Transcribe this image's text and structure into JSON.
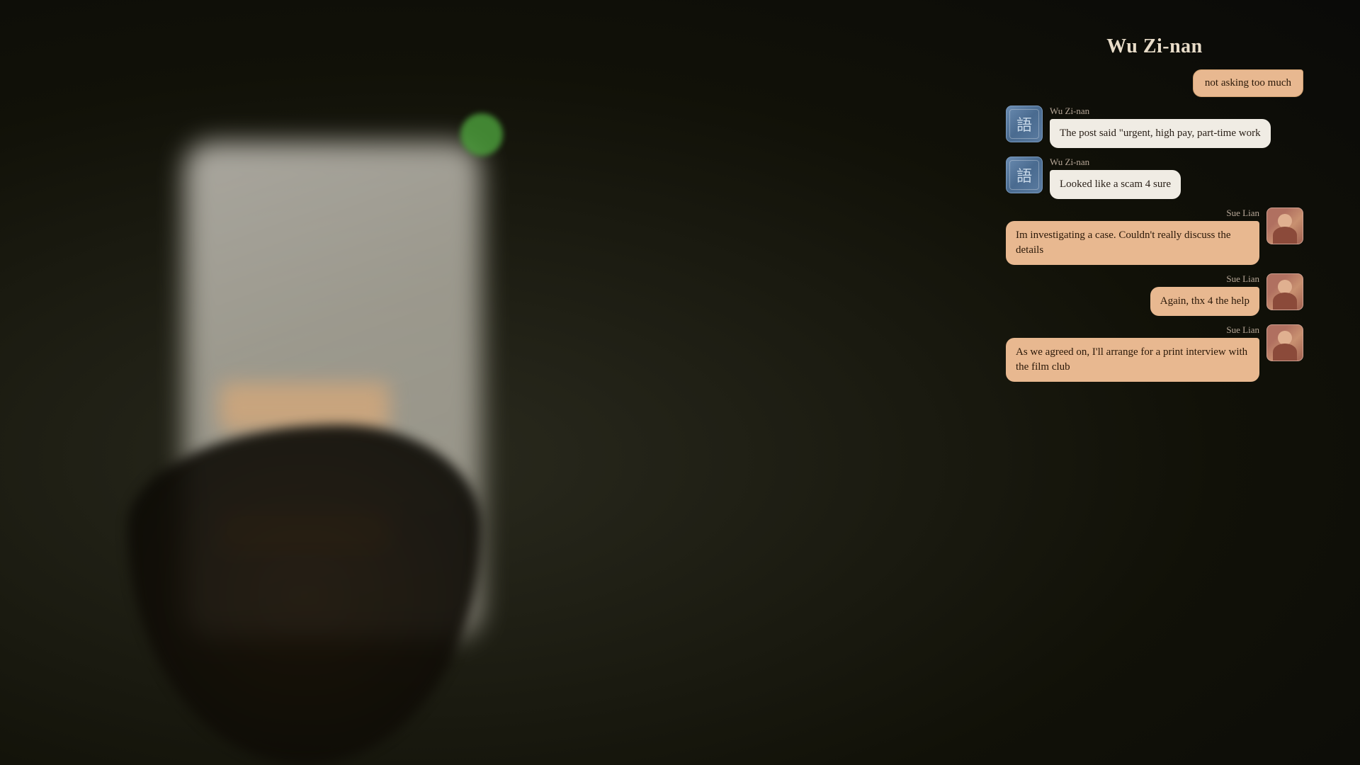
{
  "background": {
    "color": "#1a1a14"
  },
  "chat": {
    "header": "Wu Zi-nan",
    "messages": [
      {
        "id": "msg-0",
        "sender": "Sue Lian",
        "type": "sent",
        "text": "not asking too much",
        "avatar_type": "sue"
      },
      {
        "id": "msg-1",
        "sender": "Wu Zi-nan",
        "type": "received",
        "text": "The post said \"urgent, high pay, part-time work",
        "avatar_type": "wu"
      },
      {
        "id": "msg-2",
        "sender": "Wu Zi-nan",
        "type": "received",
        "text": "Looked like a scam 4 sure",
        "avatar_type": "wu"
      },
      {
        "id": "msg-3",
        "sender": "Sue Lian",
        "type": "sent",
        "text": "Im investigating a case. Couldn't really discuss the details",
        "avatar_type": "sue"
      },
      {
        "id": "msg-4",
        "sender": "Sue Lian",
        "type": "sent",
        "text": "Again, thx 4 the help",
        "avatar_type": "sue"
      },
      {
        "id": "msg-5",
        "sender": "Sue Lian",
        "type": "sent",
        "text": "As we agreed on, I'll arrange for a print interview with the film club",
        "avatar_type": "sue"
      }
    ]
  }
}
